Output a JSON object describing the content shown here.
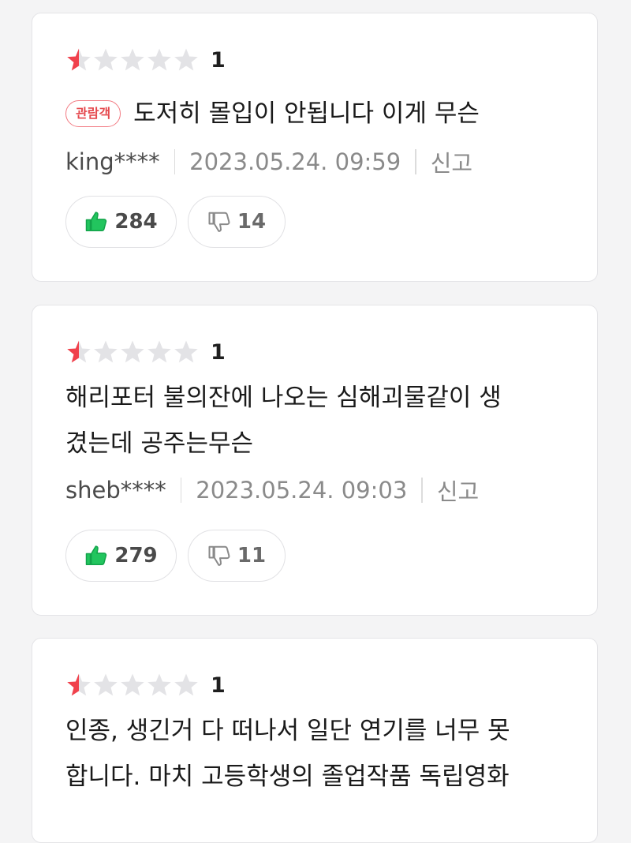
{
  "reviews": [
    {
      "score": "1",
      "rating_fraction": 0.1,
      "badge": "관람객",
      "lines": [
        "도저히 몰입이 안됩니다 이게 무슨"
      ],
      "user": "king****",
      "date": "2023.05.24. 09:59",
      "report": "신고",
      "likes": "284",
      "dislikes": "14"
    },
    {
      "score": "1",
      "rating_fraction": 0.1,
      "lines": [
        "해리포터 불의잔에 나오는 심해괴물같이 생",
        "겼는데 공주는무슨"
      ],
      "user": "sheb****",
      "date": "2023.05.24. 09:03",
      "report": "신고",
      "likes": "279",
      "dislikes": "11"
    },
    {
      "score": "1",
      "rating_fraction": 0.1,
      "lines": [
        "인종, 생긴거 다 떠나서 일단 연기를 너무 못",
        "합니다. 마치 고등학생의 졸업작품 독립영화"
      ]
    }
  ],
  "colors": {
    "star_active": "#f0414c",
    "star_inactive": "#e3e3e6",
    "like_green": "#1fb84b",
    "badge_red": "#e5484d"
  },
  "icons": {
    "like": "thumbs-up-icon",
    "dislike": "thumbs-down-icon",
    "star": "star-icon"
  }
}
